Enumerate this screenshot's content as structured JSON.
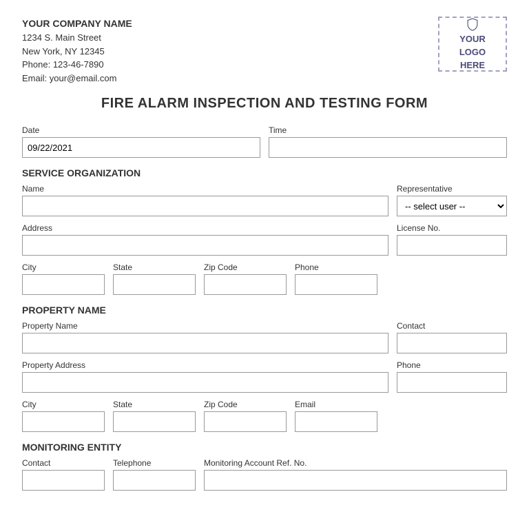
{
  "company": {
    "name": "YOUR COMPANY NAME",
    "address": "1234 S. Main Street",
    "city_state_zip": "New York, NY 12345",
    "phone": "Phone: 123-46-7890",
    "email": "Email: your@email.com"
  },
  "logo": {
    "line1": "YOUR",
    "line2": "LOGO",
    "line3": "HERE"
  },
  "form_title": "FIRE ALARM INSPECTION AND TESTING FORM",
  "fields": {
    "date_label": "Date",
    "date_value": "09/22/2021",
    "time_label": "Time",
    "service_org_title": "SERVICE ORGANIZATION",
    "name_label": "Name",
    "representative_label": "Representative",
    "select_user_placeholder": "-- select user --",
    "address_label": "Address",
    "license_label": "License No.",
    "city_label": "City",
    "state_label": "State",
    "zip_label": "Zip Code",
    "phone_label": "Phone",
    "property_name_title": "PROPERTY NAME",
    "property_name_label": "Property Name",
    "contact_label": "Contact",
    "property_address_label": "Property Address",
    "property_phone_label": "Phone",
    "property_city_label": "City",
    "property_state_label": "State",
    "property_zip_label": "Zip Code",
    "email_label": "Email",
    "monitoring_title": "MONITORING ENTITY",
    "monitoring_contact_label": "Contact",
    "telephone_label": "Telephone",
    "monitoring_account_label": "Monitoring Account Ref. No."
  }
}
